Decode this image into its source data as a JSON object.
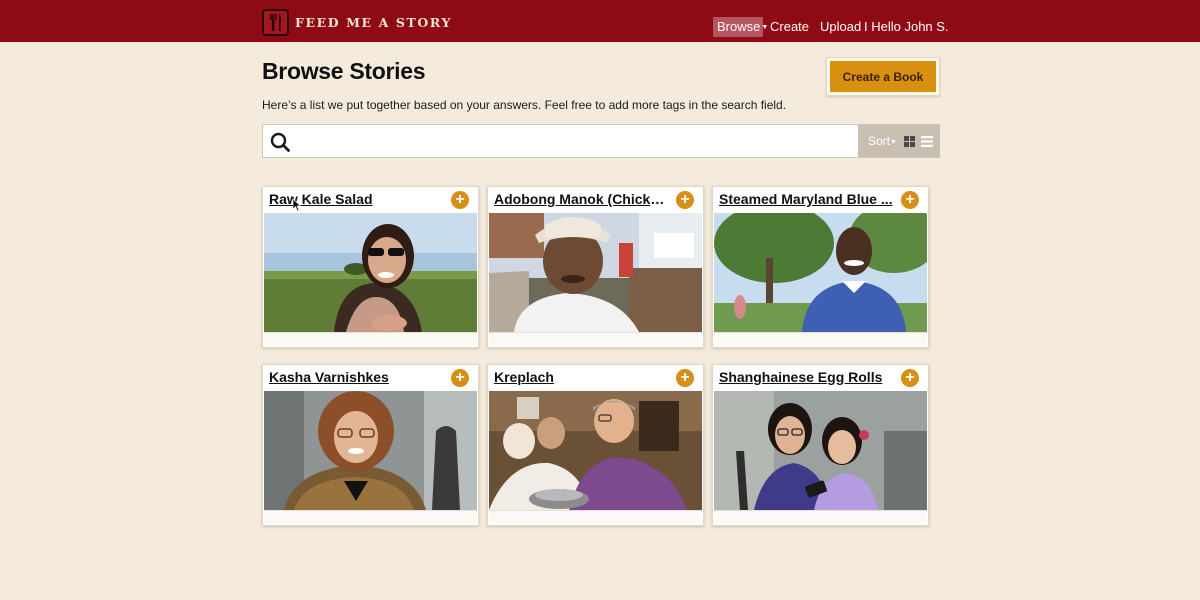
{
  "header": {
    "logo_text": "FEED ME A STORY",
    "nav": {
      "browse": "Browse",
      "create": "Create",
      "upload": "Upload",
      "user": "I Hello John S."
    }
  },
  "page": {
    "title": "Browse Stories",
    "subtitle": "Here’s a list we put together based on your answers. Feel free to add more tags in the search field.",
    "create_book_label": "Create a Book"
  },
  "search": {
    "value": "",
    "placeholder": "",
    "sort_label": "Sort"
  },
  "stories": [
    {
      "title": "Raw Kale Salad",
      "photo": "woman-sunglasses-field-icon"
    },
    {
      "title": "Adobong Manok (Chicken..",
      "photo": "man-bucket-hat-market-icon"
    },
    {
      "title": "Steamed Maryland Blue ...",
      "photo": "man-blue-shirt-park-icon"
    },
    {
      "title": "Kasha Varnishkes",
      "photo": "woman-curly-hair-icon"
    },
    {
      "title": "Kreplach",
      "photo": "cooking-group-kitchen-icon"
    },
    {
      "title": "Shanghainese Egg Rolls",
      "photo": "mother-daughter-icon"
    }
  ],
  "colors": {
    "header": "#8e0a14",
    "accent": "#d9900f",
    "background": "#f5ebdd"
  }
}
